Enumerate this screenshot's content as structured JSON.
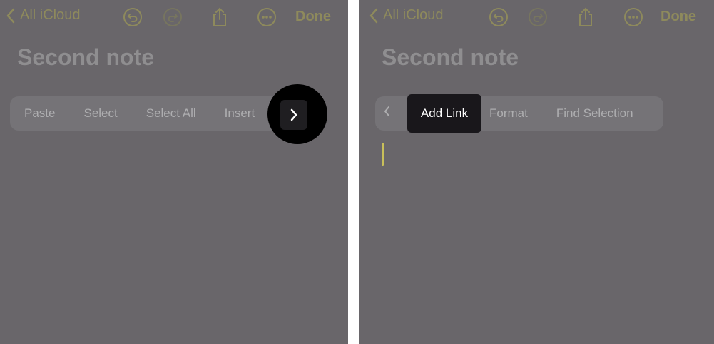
{
  "colors": {
    "accent": "#8e8a5c",
    "background": "#69666a",
    "menu": "#757377",
    "cursor": "#c8bf5a"
  },
  "left": {
    "back_label": "All iCloud",
    "done_label": "Done",
    "note_title": "Second note",
    "menu": {
      "items": [
        "Paste",
        "Select",
        "Select All",
        "Insert"
      ]
    },
    "next_icon": "chevron-right-icon"
  },
  "right": {
    "back_label": "All iCloud",
    "done_label": "Done",
    "note_title": "Second note",
    "menu": {
      "highlighted": "Add Link",
      "items": [
        "Format",
        "Find Selection"
      ]
    },
    "prev_icon": "chevron-left-icon"
  }
}
